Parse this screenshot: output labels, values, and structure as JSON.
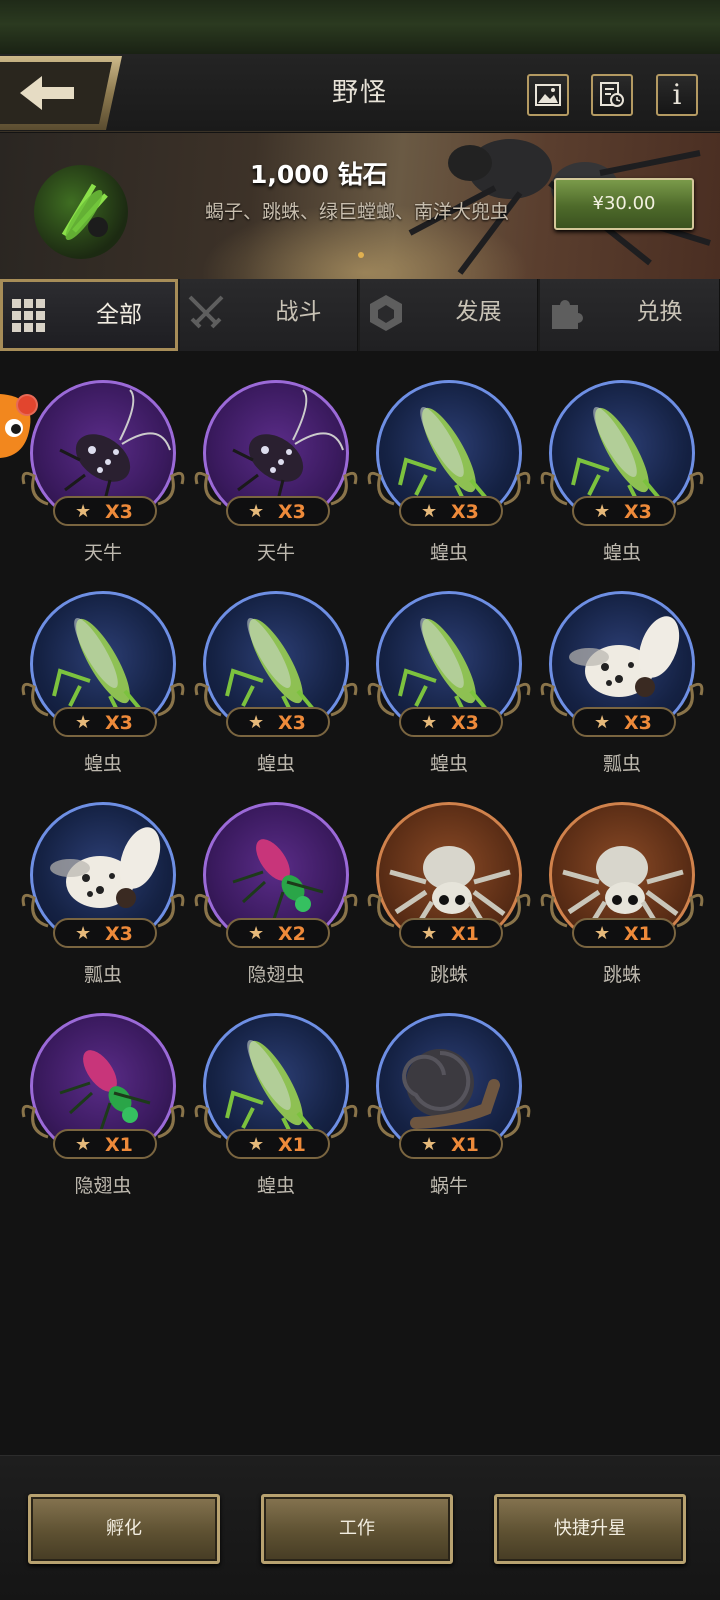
{
  "header": {
    "title": "野怪",
    "back_icon": "back-arrow-icon",
    "icons": [
      "gallery-icon",
      "record-history-icon",
      "info-icon"
    ],
    "info_label": "i"
  },
  "banner": {
    "title": "1,000 钻石",
    "subtitle": "蝎子、跳蛛、绿巨螳螂、南洋大兜虫",
    "price": "¥30.00"
  },
  "tabs": [
    {
      "label": "全部",
      "icon": "grid-icon",
      "active": true
    },
    {
      "label": "战斗",
      "icon": "crossed-swords-icon",
      "active": false
    },
    {
      "label": "发展",
      "icon": "hexagon-cube-icon",
      "active": false
    },
    {
      "label": "兑换",
      "icon": "puzzle-icon",
      "active": false
    }
  ],
  "creatures": [
    {
      "name": "天牛",
      "count": "X3",
      "rarity": "purple",
      "kind": "beetle"
    },
    {
      "name": "天牛",
      "count": "X3",
      "rarity": "purple",
      "kind": "beetle"
    },
    {
      "name": "蝗虫",
      "count": "X3",
      "rarity": "blue",
      "kind": "grasshopper"
    },
    {
      "name": "蝗虫",
      "count": "X3",
      "rarity": "blue",
      "kind": "grasshopper"
    },
    {
      "name": "蝗虫",
      "count": "X3",
      "rarity": "blue",
      "kind": "grasshopper"
    },
    {
      "name": "蝗虫",
      "count": "X3",
      "rarity": "blue",
      "kind": "grasshopper"
    },
    {
      "name": "蝗虫",
      "count": "X3",
      "rarity": "blue",
      "kind": "grasshopper"
    },
    {
      "name": "瓢虫",
      "count": "X3",
      "rarity": "blue",
      "kind": "ladybug"
    },
    {
      "name": "瓢虫",
      "count": "X3",
      "rarity": "blue",
      "kind": "ladybug"
    },
    {
      "name": "隐翅虫",
      "count": "X2",
      "rarity": "purple",
      "kind": "rove"
    },
    {
      "name": "跳蛛",
      "count": "X1",
      "rarity": "orange",
      "kind": "spider"
    },
    {
      "name": "跳蛛",
      "count": "X1",
      "rarity": "orange",
      "kind": "spider"
    },
    {
      "name": "隐翅虫",
      "count": "X1",
      "rarity": "purple",
      "kind": "rove"
    },
    {
      "name": "蝗虫",
      "count": "X1",
      "rarity": "blue",
      "kind": "grasshopper"
    },
    {
      "name": "蜗牛",
      "count": "X1",
      "rarity": "blue",
      "kind": "snail"
    }
  ],
  "star_glyph": "★",
  "bottom_buttons": [
    {
      "label": "孵化"
    },
    {
      "label": "工作"
    },
    {
      "label": "快捷升星"
    }
  ],
  "colors": {
    "gold_border": "#b49a62",
    "count_orange": "#ee8a3a",
    "rarity_blue": "#6e8fe4",
    "rarity_purple": "#9b6ad8",
    "rarity_orange": "#d0824c"
  }
}
